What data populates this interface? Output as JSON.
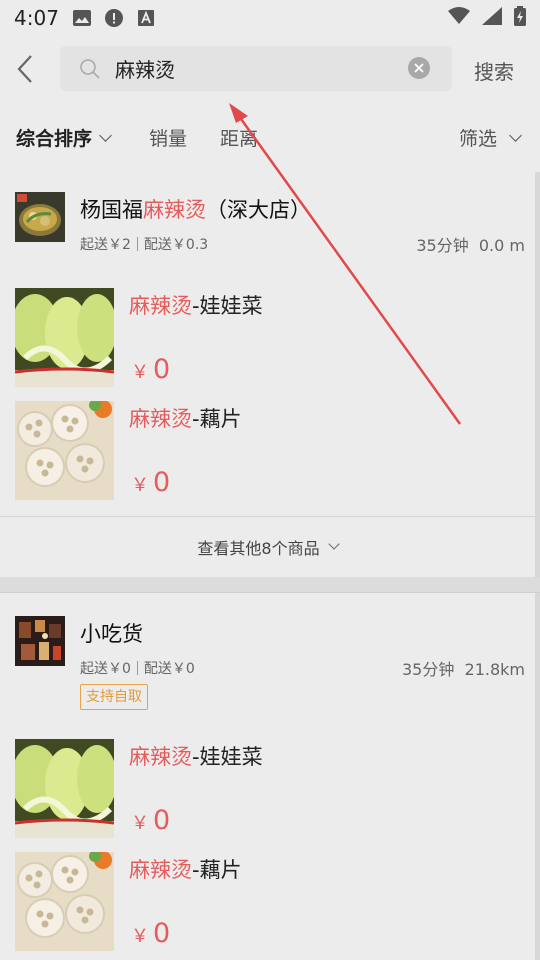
{
  "status_bar": {
    "time": "4:07",
    "icons": [
      "image-icon",
      "alert-icon",
      "a-icon"
    ],
    "right_icons": [
      "wifi-icon",
      "signal-icon",
      "battery-icon"
    ]
  },
  "search": {
    "query": "麻辣烫",
    "button_label": "搜索"
  },
  "filters": {
    "sort_label": "综合排序",
    "sales_label": "销量",
    "distance_label": "距离",
    "filter_label": "筛选"
  },
  "shops": [
    {
      "name_prefix": "杨国福",
      "name_highlight": "麻辣烫",
      "name_suffix": "（深大店）",
      "min_order": "起送￥2",
      "delivery_fee": "配送￥0.3",
      "time": "35分钟",
      "distance": "0.0 m",
      "products": [
        {
          "highlight": "麻辣烫",
          "suffix": "-娃娃菜",
          "currency": "￥",
          "price": "0"
        },
        {
          "highlight": "麻辣烫",
          "suffix": "-藕片",
          "currency": "￥",
          "price": "0"
        }
      ],
      "more_label": "查看其他8个商品"
    },
    {
      "name": "小吃货",
      "min_order": "起送￥0",
      "delivery_fee": "配送￥0",
      "time": "35分钟",
      "distance": "21.8km",
      "tag": "支持自取",
      "products": [
        {
          "highlight": "麻辣烫",
          "suffix": "-娃娃菜",
          "currency": "￥",
          "price": "0"
        },
        {
          "highlight": "麻辣烫",
          "suffix": "-藕片",
          "currency": "￥",
          "price": "0"
        }
      ]
    }
  ],
  "colors": {
    "highlight": "#e55c5c",
    "tag": "#e59a3a",
    "annotation_arrow": "#e04a4a"
  }
}
